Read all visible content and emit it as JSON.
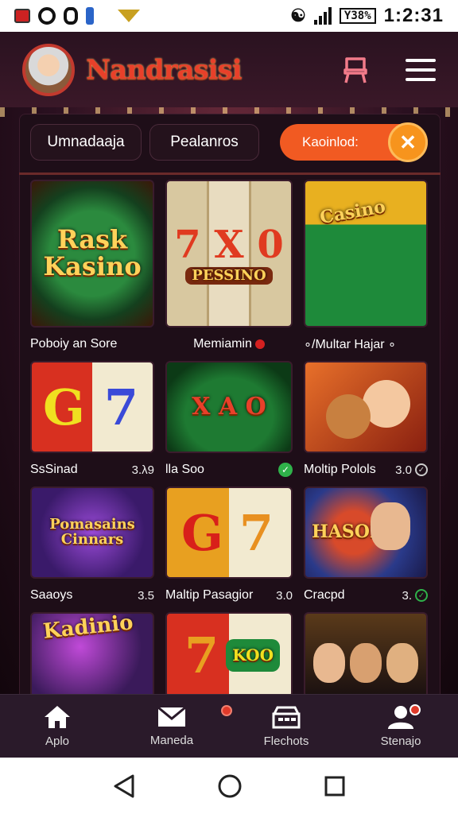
{
  "status_bar": {
    "battery": "Y38%",
    "time": "1:2:31"
  },
  "header": {
    "brand": "Nandrasisi"
  },
  "tabs": [
    {
      "label": "Umnadaaja"
    },
    {
      "label": "Pealanros"
    }
  ],
  "active_tab": {
    "label": "Kaoinlod:",
    "close_glyph": "✕"
  },
  "games": [
    {
      "art": "Rask Kasino",
      "title": "Poboiy an Sore",
      "rating": ""
    },
    {
      "art": "PESSINO",
      "title": "Memiamin",
      "rating": ""
    },
    {
      "art": "Casino",
      "title": "∘/Multar Hajar ∘",
      "rating": ""
    },
    {
      "art": "7",
      "title": "SsSinad",
      "rating": "3.λ9"
    },
    {
      "art": "X A O",
      "title": "lla Soo",
      "rating": ""
    },
    {
      "art": "",
      "title": "Moltip Polols",
      "rating": "3.0"
    },
    {
      "art": "Pomasains Cinnars",
      "title": "Saaoys",
      "rating": "3.5"
    },
    {
      "art": "7",
      "title": "Maltip Pasagior",
      "rating": "3.0"
    },
    {
      "art": "HASOIA",
      "title": "Cracpd",
      "rating": "3."
    },
    {
      "art": "Kadinio",
      "title": "",
      "rating": ""
    },
    {
      "art": "KOO",
      "title": "",
      "rating": ""
    },
    {
      "art": "",
      "title": "",
      "rating": ""
    }
  ],
  "bottom_nav": [
    {
      "label": "Aplo",
      "icon": "home-icon"
    },
    {
      "label": "Maneda",
      "icon": "mail-icon"
    },
    {
      "label": "Flechots",
      "icon": "register-icon"
    },
    {
      "label": "Stenajo",
      "icon": "user-icon"
    }
  ],
  "colors": {
    "accent": "#f15a22",
    "brand": "#e8402a",
    "success": "#2fb24a"
  }
}
